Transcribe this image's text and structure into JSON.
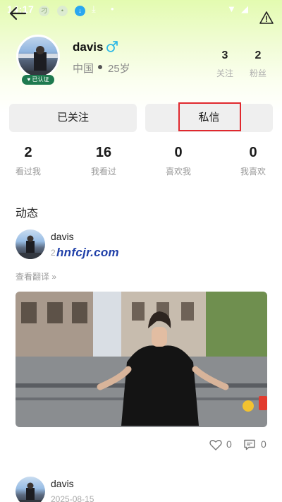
{
  "status_bar": {
    "time": "14:17"
  },
  "profile": {
    "username": "davis",
    "gender_symbol": "♂",
    "location": "中国",
    "age": "25岁",
    "verified_badge": "已认证",
    "stats": [
      {
        "value": "3",
        "label": "关注"
      },
      {
        "value": "2",
        "label": "粉丝"
      }
    ]
  },
  "actions": {
    "follow_label": "已关注",
    "message_label": "私信"
  },
  "counts": [
    {
      "value": "2",
      "label": "看过我"
    },
    {
      "value": "16",
      "label": "我看过"
    },
    {
      "value": "0",
      "label": "喜欢我"
    },
    {
      "value": "0",
      "label": "我喜欢"
    }
  ],
  "feed": {
    "section_title": "动态",
    "watermark": "hnfcjr.com",
    "posts": [
      {
        "user": "davis",
        "date": "2",
        "translate_label": "查看翻译 »",
        "likes": "0",
        "comments": "0"
      },
      {
        "user": "davis",
        "date": "2025-08-15"
      }
    ]
  },
  "colors": {
    "header_gradient_top": "#e3fbb0",
    "highlight_border": "#e0282e",
    "button_bg": "#efefef",
    "badge_green": "#1e7a4f",
    "gender_blue": "#2fb8e6",
    "watermark_blue": "#1f3fa8"
  },
  "icons": [
    "back-arrow-icon",
    "alert-triangle-icon",
    "male-gender-icon",
    "heart-icon",
    "comment-icon"
  ]
}
